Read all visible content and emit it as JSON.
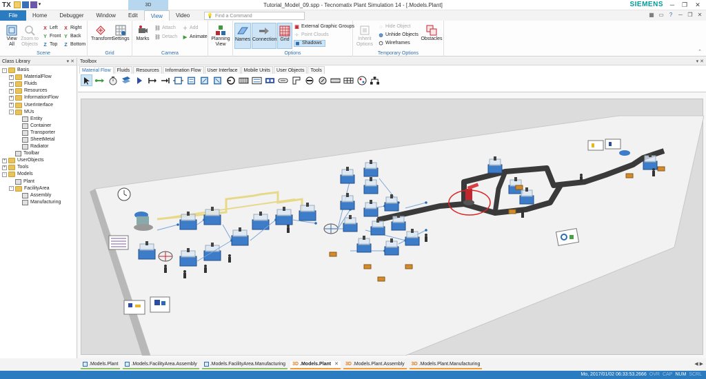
{
  "titlebar": {
    "logo": "TX",
    "title": "Tutorial_Model_09.spp - Tecnomatix Plant Simulation 14 - [.Models.Plant]",
    "brand": "SIEMENS",
    "context_tab": "3D",
    "min": "─",
    "max": "❐",
    "close": "✕"
  },
  "ribbon_tabs": [
    "File",
    "Home",
    "Debugger",
    "Window",
    "Edit",
    "View",
    "Video"
  ],
  "command_placeholder": "Find a Command",
  "ribbon": {
    "scene": {
      "label": "Scene",
      "view_all": "View All",
      "zoom_to_objects": "Zoom to Objects",
      "left": "Left",
      "right": "Right",
      "front": "Front",
      "back": "Back",
      "top": "Top",
      "bottom": "Bottom"
    },
    "grid": {
      "label": "Grid",
      "transform": "Transform",
      "settings": "Settings"
    },
    "camera": {
      "label": "Camera",
      "marks": "Marks",
      "attach": "Attach",
      "detach": "Detach",
      "add": "Add",
      "animate": "Animate"
    },
    "planning": {
      "planning_view": "Planning View"
    },
    "options": {
      "label": "Options",
      "names": "Names",
      "connections": "Connections",
      "grid": "Grid",
      "external_graphic_groups": "External Graphic Groups",
      "point_clouds": "Point Clouds",
      "shadows": "Shadows"
    },
    "temp": {
      "label": "Temporary Options",
      "inherit_options": "Inherit Options",
      "hide_object": "Hide Object",
      "unhide_objects": "Unhide Objects",
      "wireframes": "Wireframes",
      "obstacles": "Obstacles"
    }
  },
  "class_library": {
    "title": "Class Library",
    "items": [
      {
        "label": "Basis",
        "level": 0,
        "type": "folder",
        "exp": "-"
      },
      {
        "label": "MaterialFlow",
        "level": 1,
        "type": "folder",
        "exp": "+"
      },
      {
        "label": "Fluids",
        "level": 1,
        "type": "folder",
        "exp": "+"
      },
      {
        "label": "Resources",
        "level": 1,
        "type": "folder",
        "exp": "+"
      },
      {
        "label": "InformationFlow",
        "level": 1,
        "type": "folder",
        "exp": "+"
      },
      {
        "label": "UserInterface",
        "level": 1,
        "type": "folder",
        "exp": "+"
      },
      {
        "label": "MUs",
        "level": 1,
        "type": "folder",
        "exp": "-"
      },
      {
        "label": "Entity",
        "level": 2,
        "type": "obj",
        "exp": ""
      },
      {
        "label": "Container",
        "level": 2,
        "type": "obj",
        "exp": ""
      },
      {
        "label": "Transporter",
        "level": 2,
        "type": "obj",
        "exp": ""
      },
      {
        "label": "SheetMetal",
        "level": 2,
        "type": "obj",
        "exp": ""
      },
      {
        "label": "Radiator",
        "level": 2,
        "type": "obj",
        "exp": ""
      },
      {
        "label": "Toolbar",
        "level": 1,
        "type": "obj",
        "exp": ""
      },
      {
        "label": "UserObjects",
        "level": 0,
        "type": "folder",
        "exp": "+"
      },
      {
        "label": "Tools",
        "level": 0,
        "type": "folder",
        "exp": "+"
      },
      {
        "label": "Models",
        "level": 0,
        "type": "folder",
        "exp": "-"
      },
      {
        "label": "Plant",
        "level": 1,
        "type": "obj",
        "exp": ""
      },
      {
        "label": "FacilityArea",
        "level": 1,
        "type": "folder",
        "exp": "-"
      },
      {
        "label": "Assembly",
        "level": 2,
        "type": "obj",
        "exp": ""
      },
      {
        "label": "Manufacturing",
        "level": 2,
        "type": "obj",
        "exp": ""
      }
    ]
  },
  "toolbox": {
    "title": "Toolbox",
    "tabs": [
      "Material Flow",
      "Fluids",
      "Resources",
      "Information Flow",
      "User Interface",
      "Mobile Units",
      "User Objects",
      "Tools"
    ]
  },
  "doc_tabs": [
    {
      "label": ".Models.Plant",
      "prefix": "",
      "active": false
    },
    {
      "label": ".Models.FacilityArea.Assembly",
      "prefix": "",
      "active": false
    },
    {
      "label": ".Models.FacilityArea.Manufacturing",
      "prefix": "",
      "active": false
    },
    {
      "label": ".Models.Plant",
      "prefix": "3D",
      "active": true
    },
    {
      "label": ".Models.Plant.Assembly",
      "prefix": "3D",
      "active": false
    },
    {
      "label": ".Models.Plant.Manufacturing",
      "prefix": "3D",
      "active": false
    }
  ],
  "status": {
    "datetime": "Mo, 2017/01/02 06:33:53.2666",
    "ovr": "OVR",
    "cap": "CAP",
    "num": "NUM",
    "scrl": "SCRL"
  },
  "colors": {
    "accent": "#2b7bc0",
    "conveyor": "#3a3a3a",
    "station": "#3d7cc9",
    "floor": "#f2f2f2"
  }
}
